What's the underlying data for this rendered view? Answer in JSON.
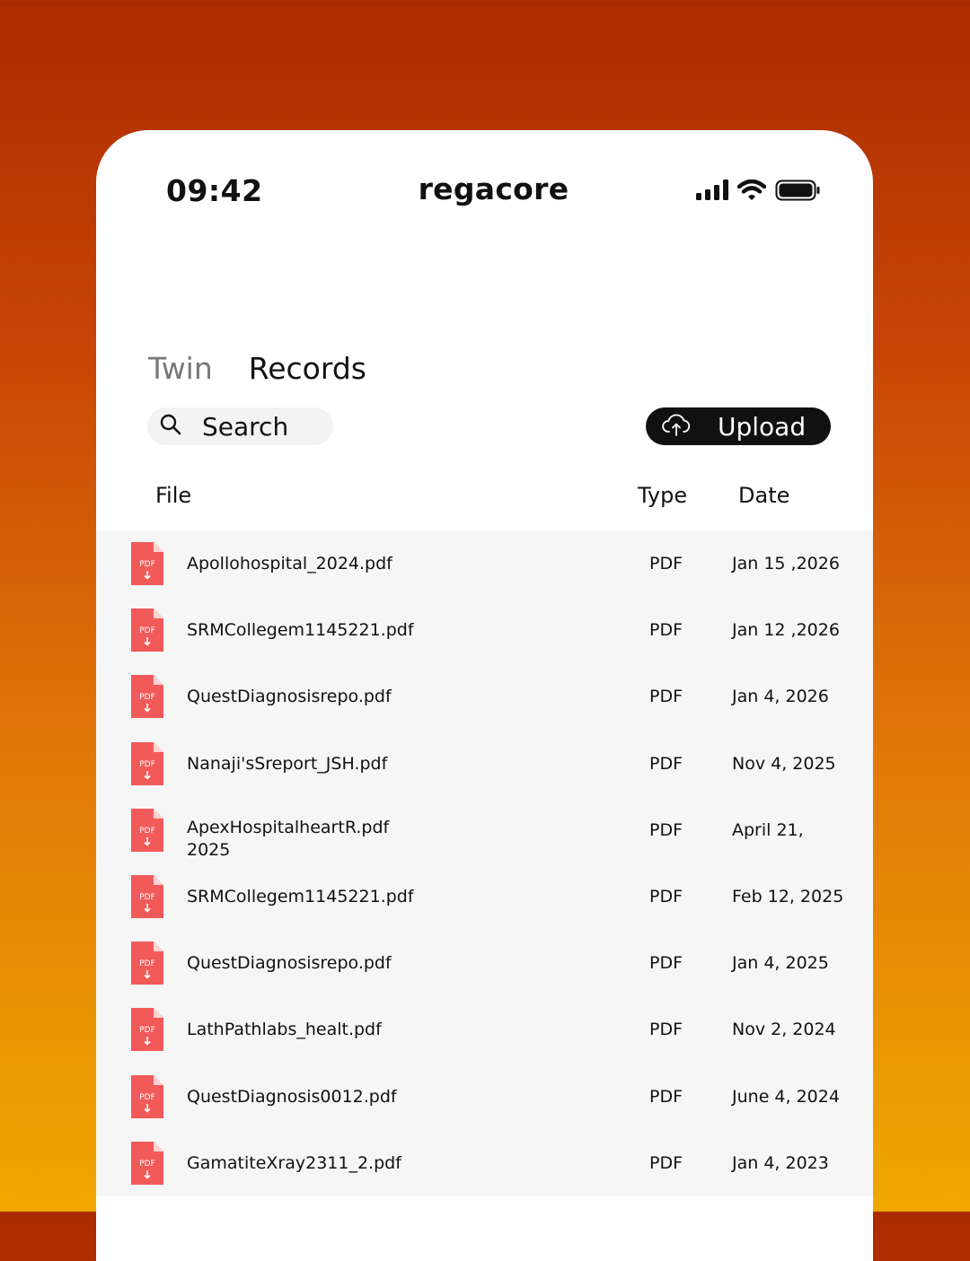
{
  "status_bar": {
    "time": "09:42",
    "icons": [
      "signal-icon",
      "wifi-icon",
      "battery-icon"
    ]
  },
  "app": {
    "name": "regacore"
  },
  "tabs": [
    {
      "label": "Twin",
      "active": false
    },
    {
      "label": "Records",
      "active": true
    }
  ],
  "search": {
    "label": "Search",
    "icon": "search-icon"
  },
  "upload": {
    "label": "Upload",
    "icon": "cloud-upload-icon"
  },
  "table": {
    "columns": [
      "File",
      "Type",
      "Date"
    ],
    "rows": [
      {
        "file": "Apollohospital_2024.pdf",
        "type": "PDF",
        "date": "Jan 15 ,2026"
      },
      {
        "file": "SRMCollegem1145221.pdf",
        "type": "PDF",
        "date": "Jan 12 ,2026"
      },
      {
        "file": "QuestDiagnosisrepo.pdf",
        "type": "PDF",
        "date": "Jan  4, 2026"
      },
      {
        "file": "Nanaji'sSreport_JSH.pdf",
        "type": "PDF",
        "date": "Nov 4, 2025"
      },
      {
        "file": "ApexHospitalheartR.pdf 2025",
        "type": "PDF",
        "date": "April 21,"
      },
      {
        "file": "SRMCollegem1145221.pdf",
        "type": "PDF",
        "date": "Feb 12, 2025"
      },
      {
        "file": "QuestDiagnosisrepo.pdf",
        "type": "PDF",
        "date": "Jan 4, 2025"
      },
      {
        "file": "LathPathlabs_healt.pdf",
        "type": "PDF",
        "date": "Nov 2, 2024"
      },
      {
        "file": "QuestDiagnosis0012.pdf",
        "type": "PDF",
        "date": "June 4, 2024"
      },
      {
        "file": "GamatiteXray2311_2.pdf",
        "type": "PDF",
        "date": "Jan 4, 2023"
      }
    ]
  },
  "colors": {
    "accent_pdf": "#f25a5a",
    "button_dark": "#111111",
    "row_bg": "#f6f6f6"
  },
  "file_icon_label": "PDF"
}
